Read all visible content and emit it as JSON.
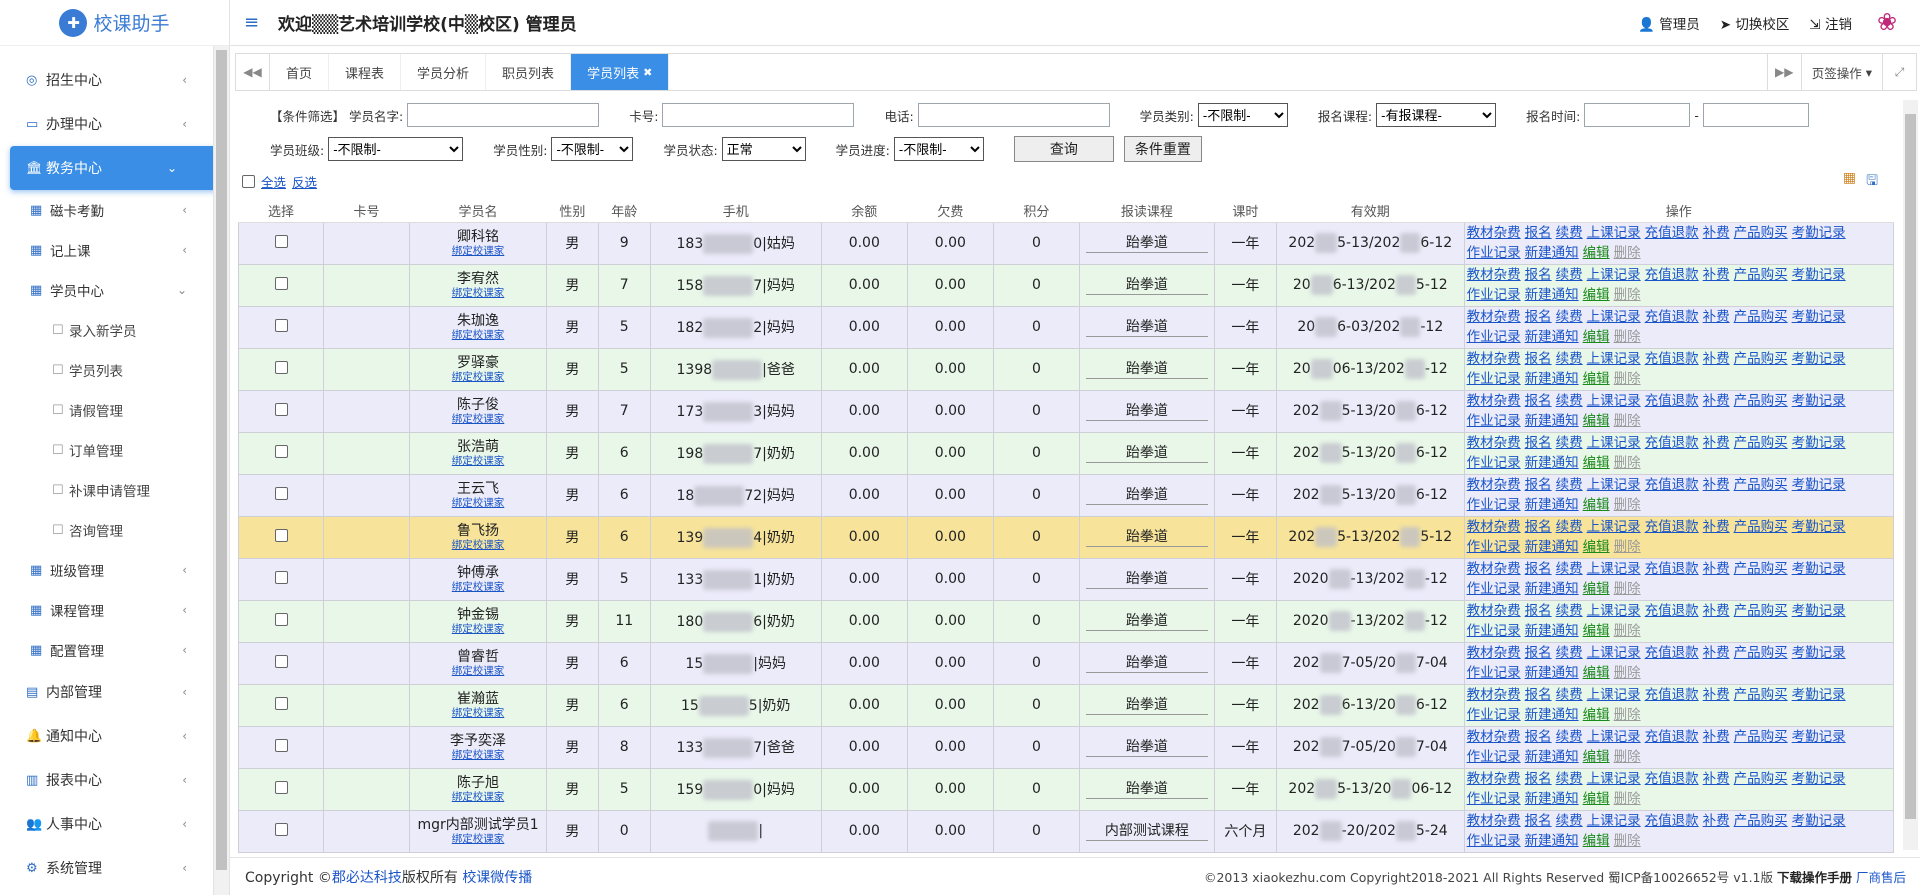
{
  "app": {
    "logo_text": "校课助手"
  },
  "header": {
    "welcome": "欢迎▒▒艺术培训学校(中▒校区) 管理员",
    "admin": "管理员",
    "switch_campus": "切换校区",
    "logout": "注销"
  },
  "sidebar": {
    "items": [
      {
        "label": "招生中心",
        "icon": "target-icon",
        "arrow": "‹"
      },
      {
        "label": "办理中心",
        "icon": "monitor-icon",
        "arrow": "‹"
      },
      {
        "label": "教务中心",
        "icon": "bank-icon",
        "arrow": "⌄",
        "active": true
      },
      {
        "label": "磁卡考勤",
        "icon": "grid-icon",
        "arrow": "‹"
      },
      {
        "label": "记上课",
        "icon": "grid-icon",
        "arrow": "‹"
      },
      {
        "label": "学员中心",
        "icon": "grid-icon",
        "arrow": "⌄"
      },
      {
        "label": "录入新学员",
        "icon": "window-icon"
      },
      {
        "label": "学员列表",
        "icon": "window-icon"
      },
      {
        "label": "请假管理",
        "icon": "window-icon"
      },
      {
        "label": "订单管理",
        "icon": "window-icon"
      },
      {
        "label": "补课申请管理",
        "icon": "window-icon"
      },
      {
        "label": "咨询管理",
        "icon": "window-icon"
      },
      {
        "label": "班级管理",
        "icon": "grid-icon",
        "arrow": "‹"
      },
      {
        "label": "课程管理",
        "icon": "grid-icon",
        "arrow": "‹"
      },
      {
        "label": "配置管理",
        "icon": "grid-icon",
        "arrow": "‹"
      },
      {
        "label": "内部管理",
        "icon": "book-icon",
        "arrow": "‹"
      },
      {
        "label": "通知中心",
        "icon": "bell-icon",
        "arrow": "‹"
      },
      {
        "label": "报表中心",
        "icon": "bar-chart-icon",
        "arrow": "‹"
      },
      {
        "label": "人事中心",
        "icon": "users-icon",
        "arrow": "‹"
      },
      {
        "label": "系统管理",
        "icon": "gear-icon",
        "arrow": "‹"
      }
    ]
  },
  "tabs": {
    "items": [
      "首页",
      "课程表",
      "学员分析",
      "职员列表",
      "学员列表"
    ],
    "menu": "页签操作"
  },
  "filter": {
    "tag": "【条件筛选】",
    "name_label": "学员名字:",
    "card_label": "卡号:",
    "phone_label": "电话:",
    "type_label": "学员类别:",
    "type_value": "-不限制-",
    "course_label": "报名课程:",
    "course_value": "-有报课程-",
    "time_label": "报名时间:",
    "time_sep": "-",
    "class_label": "学员班级:",
    "class_value": "-不限制-",
    "gender_label": "学员性别:",
    "gender_value": "-不限制-",
    "status_label": "学员状态:",
    "status_value": "正常",
    "progress_label": "学员进度:",
    "progress_value": "-不限制-",
    "query_btn": "查询",
    "reset_btn": "条件重置"
  },
  "selection": {
    "select_all": "全选",
    "invert": "反选"
  },
  "table": {
    "columns": [
      "选择",
      "卡号",
      "学员名",
      "性别",
      "年龄",
      "手机",
      "余额",
      "欠费",
      "积分",
      "报读课程",
      "课时",
      "有效期",
      "操作"
    ],
    "bind_link": "绑定校课家",
    "ops": [
      "教材杂费",
      "报名",
      "续费",
      "上课记录",
      "充值退款",
      "补费",
      "产品购买",
      "考勤记录",
      "作业记录",
      "新建通知",
      "编辑",
      "删除"
    ],
    "rows": [
      {
        "name": "卿科铭",
        "gender": "男",
        "age": "9",
        "phone_a": "183",
        "phone_b": "0|姑妈",
        "balance": "0.00",
        "debt": "0.00",
        "points": "0",
        "course": "跆拳道",
        "hours": "一年",
        "valid_a": "202",
        "valid_b": "5-13/202",
        "valid_c": "6-12"
      },
      {
        "name": "李宥然",
        "gender": "男",
        "age": "7",
        "phone_a": "158",
        "phone_b": "7|妈妈",
        "balance": "0.00",
        "debt": "0.00",
        "points": "0",
        "course": "跆拳道",
        "hours": "一年",
        "valid_a": "20",
        "valid_b": "6-13/202",
        "valid_c": "5-12"
      },
      {
        "name": "朱珈逸",
        "gender": "男",
        "age": "5",
        "phone_a": "182",
        "phone_b": "2|妈妈",
        "balance": "0.00",
        "debt": "0.00",
        "points": "0",
        "course": "跆拳道",
        "hours": "一年",
        "valid_a": "20",
        "valid_b": "6-03/202",
        "valid_c": "-12"
      },
      {
        "name": "罗驿豪",
        "gender": "男",
        "age": "5",
        "phone_a": "1398",
        "phone_b": "|爸爸",
        "balance": "0.00",
        "debt": "0.00",
        "points": "0",
        "course": "跆拳道",
        "hours": "一年",
        "valid_a": "20",
        "valid_b": "06-13/202",
        "valid_c": "-12"
      },
      {
        "name": "陈子俊",
        "gender": "男",
        "age": "7",
        "phone_a": "173",
        "phone_b": "3|妈妈",
        "balance": "0.00",
        "debt": "0.00",
        "points": "0",
        "course": "跆拳道",
        "hours": "一年",
        "valid_a": "202",
        "valid_b": "5-13/20",
        "valid_c": "6-12"
      },
      {
        "name": "张浩萌",
        "gender": "男",
        "age": "6",
        "phone_a": "198",
        "phone_b": "7|奶奶",
        "balance": "0.00",
        "debt": "0.00",
        "points": "0",
        "course": "跆拳道",
        "hours": "一年",
        "valid_a": "202",
        "valid_b": "5-13/20",
        "valid_c": "6-12"
      },
      {
        "name": "王云飞",
        "gender": "男",
        "age": "6",
        "phone_a": "18",
        "phone_b": "72|妈妈",
        "balance": "0.00",
        "debt": "0.00",
        "points": "0",
        "course": "跆拳道",
        "hours": "一年",
        "valid_a": "202",
        "valid_b": "5-13/20",
        "valid_c": "6-12"
      },
      {
        "name": "鲁飞扬",
        "gender": "男",
        "age": "6",
        "phone_a": "139",
        "phone_b": "4|奶奶",
        "balance": "0.00",
        "debt": "0.00",
        "points": "0",
        "course": "跆拳道",
        "hours": "一年",
        "valid_a": "202",
        "valid_b": "5-13/202",
        "valid_c": "5-12",
        "highlight": true
      },
      {
        "name": "钟傅承",
        "gender": "男",
        "age": "5",
        "phone_a": "133",
        "phone_b": "1|奶奶",
        "balance": "0.00",
        "debt": "0.00",
        "points": "0",
        "course": "跆拳道",
        "hours": "一年",
        "valid_a": "2020",
        "valid_b": "-13/202",
        "valid_c": "-12"
      },
      {
        "name": "钟金锡",
        "gender": "男",
        "age": "11",
        "phone_a": "180",
        "phone_b": "6|奶奶",
        "balance": "0.00",
        "debt": "0.00",
        "points": "0",
        "course": "跆拳道",
        "hours": "一年",
        "valid_a": "2020",
        "valid_b": "-13/202",
        "valid_c": "-12"
      },
      {
        "name": "曾睿哲",
        "gender": "男",
        "age": "6",
        "phone_a": "15",
        "phone_b": "|妈妈",
        "balance": "0.00",
        "debt": "0.00",
        "points": "0",
        "course": "跆拳道",
        "hours": "一年",
        "valid_a": "202",
        "valid_b": "7-05/20",
        "valid_c": "7-04"
      },
      {
        "name": "崔瀚蓝",
        "gender": "男",
        "age": "6",
        "phone_a": "15",
        "phone_b": "5|奶奶",
        "balance": "0.00",
        "debt": "0.00",
        "points": "0",
        "course": "跆拳道",
        "hours": "一年",
        "valid_a": "202",
        "valid_b": "6-13/20",
        "valid_c": "6-12"
      },
      {
        "name": "李予奕泽",
        "gender": "男",
        "age": "8",
        "phone_a": "133",
        "phone_b": "7|爸爸",
        "balance": "0.00",
        "debt": "0.00",
        "points": "0",
        "course": "跆拳道",
        "hours": "一年",
        "valid_a": "202",
        "valid_b": "7-05/20",
        "valid_c": "7-04"
      },
      {
        "name": "陈子旭",
        "gender": "男",
        "age": "5",
        "phone_a": "159",
        "phone_b": "0|妈妈",
        "balance": "0.00",
        "debt": "0.00",
        "points": "0",
        "course": "跆拳道",
        "hours": "一年",
        "valid_a": "202",
        "valid_b": "5-13/20",
        "valid_c": "06-12"
      },
      {
        "name": "mgr内部测试学员1",
        "gender": "男",
        "age": "0",
        "phone_a": "",
        "phone_b": "|",
        "balance": "0.00",
        "debt": "0.00",
        "points": "0",
        "course": "内部测试课程",
        "hours": "六个月",
        "valid_a": "202",
        "valid_b": "-20/202",
        "valid_c": "5-24"
      }
    ]
  },
  "footer": {
    "copy_prefix": "Copyright ©",
    "company": "郡必达科技",
    "rights": "版权所有",
    "product": "校课微传播",
    "right_text": "©2013 xiaokezhu.com Copyright2018-2021 All Rights Reserved 蜀ICP备10026652号 v1.1版",
    "manual": "下载操作手册",
    "after_sales": "厂商售后"
  }
}
